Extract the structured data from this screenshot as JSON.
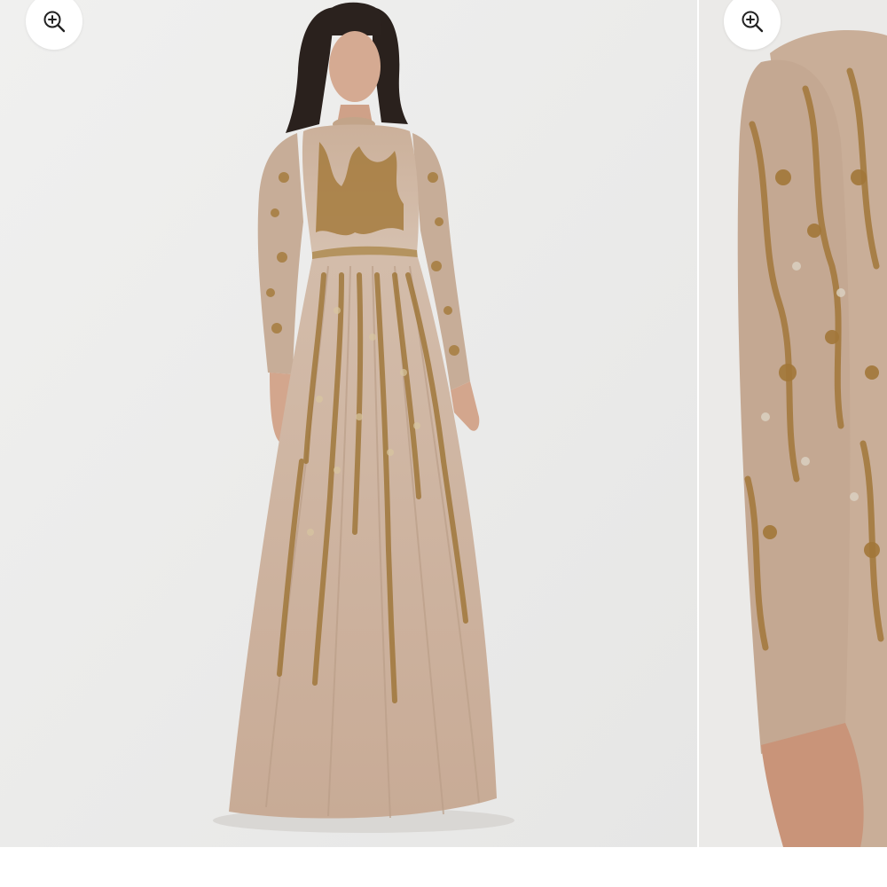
{
  "gallery": {
    "slides": [
      {
        "icon": "zoom-in-icon",
        "image": "model-full-length-gown-photo"
      },
      {
        "icon": "zoom-in-icon",
        "image": "sleeve-embellishment-closeup-photo"
      }
    ]
  },
  "colors": {
    "background": "#ededed",
    "gown": "#c9ad98",
    "embellishment": "#a77d3f",
    "zoom_button": "#ffffff",
    "zoom_icon": "#222222"
  }
}
